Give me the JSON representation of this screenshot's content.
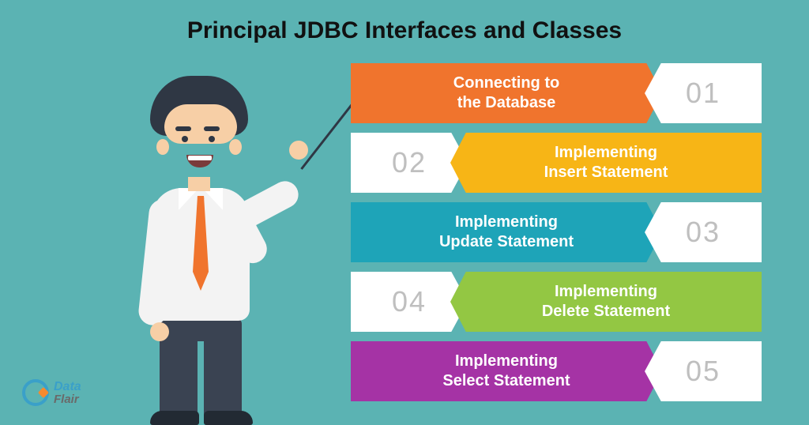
{
  "title": "Principal JDBC Interfaces and Classes",
  "logo": {
    "line1": "Data",
    "line2": "Flair"
  },
  "items": [
    {
      "number": "01",
      "label_line1": "Connecting to",
      "label_line2": "the Database",
      "side": "right",
      "color": "#f0742d"
    },
    {
      "number": "02",
      "label_line1": "Implementing",
      "label_line2": "Insert Statement",
      "side": "left",
      "color": "#f7b516"
    },
    {
      "number": "03",
      "label_line1": "Implementing",
      "label_line2": "Update Statement",
      "side": "right",
      "color": "#1ea4b8"
    },
    {
      "number": "04",
      "label_line1": "Implementing",
      "label_line2": "Delete Statement",
      "side": "left",
      "color": "#93c743"
    },
    {
      "number": "05",
      "label_line1": "Implementing",
      "label_line2": "Select Statement",
      "side": "right",
      "color": "#a533a5"
    }
  ]
}
